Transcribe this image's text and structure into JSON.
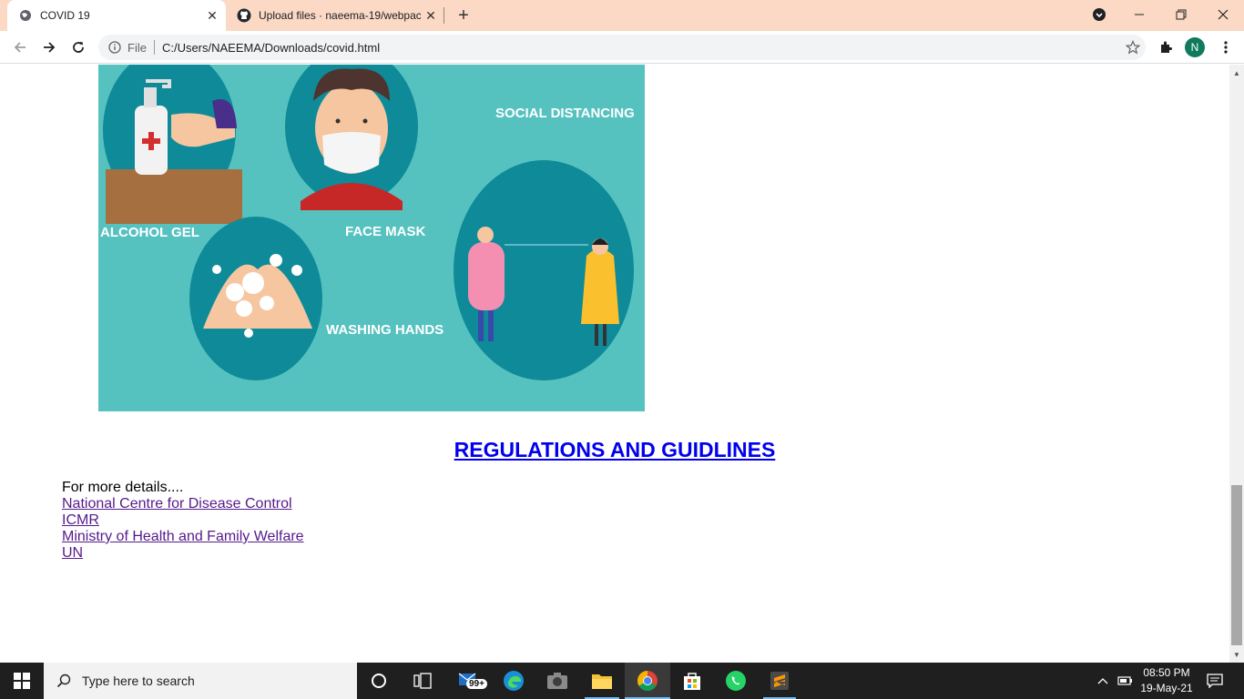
{
  "browser": {
    "tabs": [
      {
        "title": "COVID 19",
        "active": true
      },
      {
        "title": "Upload files · naeema-19/webpac",
        "active": false
      }
    ],
    "omnibox": {
      "scheme_label": "File",
      "url": "C:/Users/NAEEMA/Downloads/covid.html"
    },
    "profile_initial": "N"
  },
  "page": {
    "hero_labels": {
      "alcohol_gel": "ALCOHOL GEL",
      "face_mask": "FACE MASK",
      "washing_hands": "WASHING HANDS",
      "social_distancing": "SOCIAL DISTANCING"
    },
    "regulations_link": "REGULATIONS AND GUIDLINES",
    "details_text": "For more details....",
    "links": [
      "National Centre for Disease Control",
      "ICMR",
      "Ministry of Health and Family Welfare",
      "UN"
    ]
  },
  "taskbar": {
    "search_placeholder": "Type here to search",
    "mail_badge": "99+",
    "time": "08:50 PM",
    "date": "19-May-21"
  },
  "colors": {
    "tabstrip": "#fbd9c4",
    "hero_background": "#56c2c0",
    "hero_circle": "#0e8a99",
    "link_visited": "#551a8b",
    "link_unvisited": "#0000ee"
  }
}
